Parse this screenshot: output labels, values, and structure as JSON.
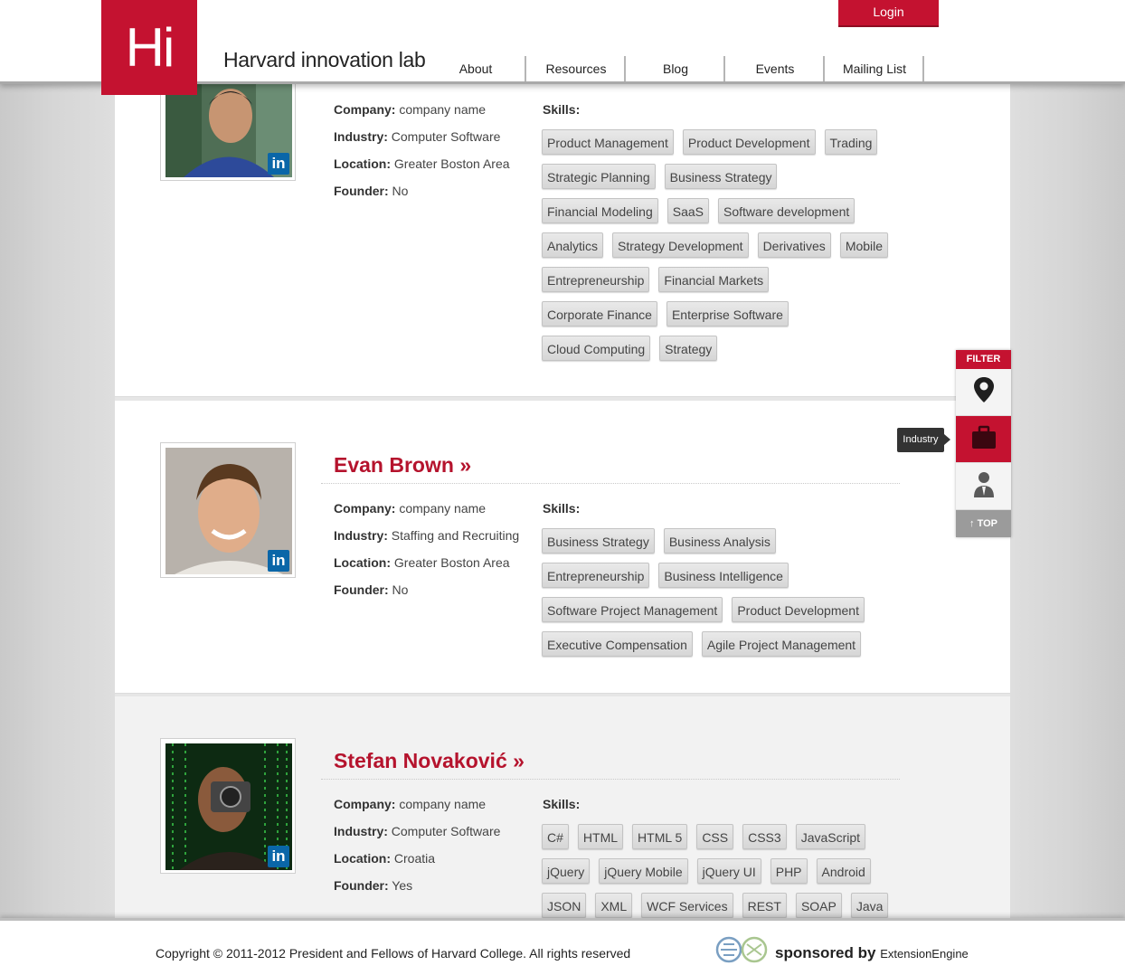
{
  "header": {
    "logo_mark": "Hi",
    "logo_text": "Harvard innovation lab",
    "login_label": "Login",
    "nav": [
      "About",
      "Resources",
      "Blog",
      "Events",
      "Mailing List"
    ]
  },
  "colors": {
    "brand_red": "#c41230",
    "name_red": "#b5132d",
    "linkedin_blue": "#0a66a8"
  },
  "labels": {
    "company": "Company:",
    "industry": "Industry:",
    "location": "Location:",
    "founder": "Founder:",
    "skills": "Skills:"
  },
  "profiles": [
    {
      "name": "",
      "company": "company name",
      "industry": "Computer Software",
      "location": "Greater Boston Area",
      "founder": "No",
      "skill_rows": [
        [
          "Product Management",
          "Product Development",
          "Trading"
        ],
        [
          "Strategic Planning",
          "Business Strategy"
        ],
        [
          "Financial Modeling",
          "SaaS",
          "Software development"
        ],
        [
          "Analytics",
          "Strategy Development",
          "Derivatives",
          "Mobile"
        ],
        [
          "Entrepreneurship",
          "Financial Markets"
        ],
        [
          "Corporate Finance",
          "Enterprise Software"
        ],
        [
          "Cloud Computing",
          "Strategy"
        ]
      ]
    },
    {
      "name": "Evan Brown",
      "company": "company name",
      "industry": "Staffing and Recruiting",
      "location": "Greater Boston Area",
      "founder": "No",
      "skill_rows": [
        [
          "Business Strategy",
          "Business Analysis"
        ],
        [
          "Entrepreneurship",
          "Business Intelligence"
        ],
        [
          "Software Project Management",
          "Product Development"
        ],
        [
          "Executive Compensation",
          "Agile Project Management"
        ]
      ]
    },
    {
      "name": "Stefan Novaković",
      "company": "company name",
      "industry": "Computer Software",
      "location": "Croatia",
      "founder": "Yes",
      "skill_rows": [
        [
          "C#",
          "HTML",
          "HTML 5",
          "CSS",
          "CSS3",
          "JavaScript"
        ],
        [
          "jQuery",
          "jQuery Mobile",
          "jQuery UI",
          "PHP",
          "Android"
        ],
        [
          "JSON",
          "XML",
          "WCF Services",
          "REST",
          "SOAP",
          "Java"
        ]
      ]
    }
  ],
  "filter": {
    "title": "FILTER",
    "buttons": [
      {
        "icon": "location-pin-icon"
      },
      {
        "icon": "briefcase-icon",
        "active": true
      },
      {
        "icon": "person-icon"
      }
    ],
    "tooltip": "Industry",
    "top_label": "TOP"
  },
  "footer": {
    "copyright": "Copyright © 2011-2012 President and Fellows of Harvard College. All rights reserved",
    "sponsored_by": "sponsored by",
    "sponsor_name": "ExtensionEngine"
  }
}
